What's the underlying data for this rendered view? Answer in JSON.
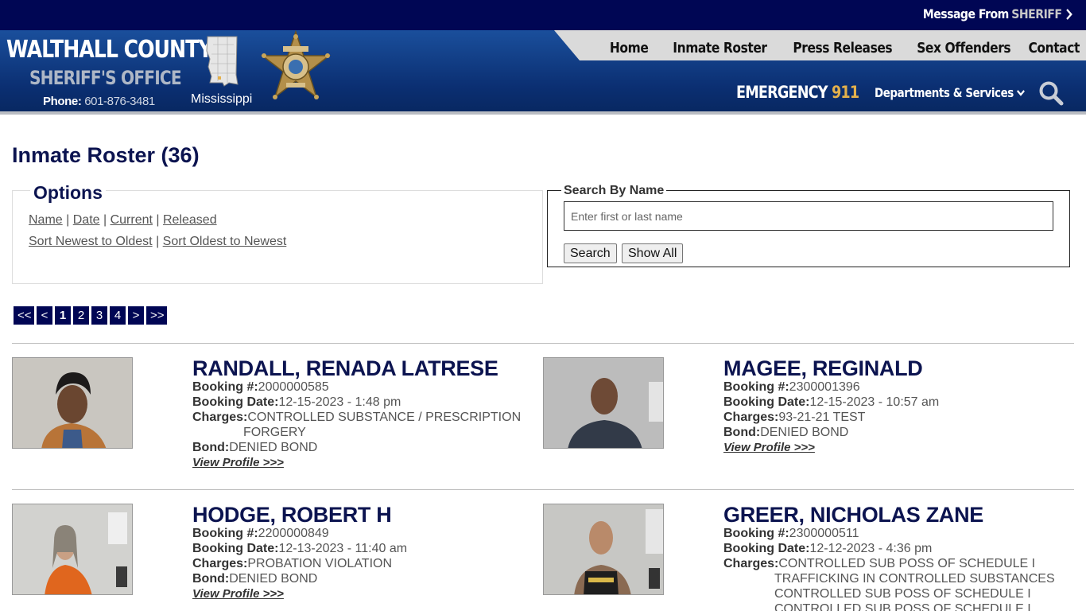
{
  "topbar": {
    "message_prefix": "Message From",
    "message_highlight": "SHERIFF"
  },
  "brand": {
    "title": "WALTHALL COUNTY",
    "subtitle": "SHERIFF'S OFFICE",
    "phone_label": "Phone:",
    "phone_number": "601-876-3481",
    "state": "Mississippi"
  },
  "nav": {
    "items": [
      "Home",
      "Inmate Roster",
      "Press Releases",
      "Sex Offenders",
      "Contact"
    ],
    "emergency_label": "EMERGENCY",
    "emergency_number": "911",
    "departments": "Departments & Services"
  },
  "page": {
    "title": "Inmate Roster (36)"
  },
  "options": {
    "legend": "Options",
    "sort_fields": [
      "Name",
      "Date",
      "Current",
      "Released"
    ],
    "sort_orders": [
      "Sort Newest to Oldest",
      "Sort Oldest to Newest"
    ]
  },
  "search": {
    "legend": "Search By Name",
    "placeholder": "Enter first or last name",
    "search_button": "Search",
    "show_all_button": "Show All"
  },
  "pager": {
    "first": "<<",
    "prev": "<",
    "pages": [
      "1",
      "2",
      "3",
      "4"
    ],
    "next": ">",
    "last": ">>",
    "current": "1"
  },
  "labels": {
    "booking_no": "Booking #:",
    "booking_date": "Booking Date:",
    "charges": "Charges:",
    "bond": "Bond:",
    "view_profile": "View Profile >>>"
  },
  "inmates": [
    {
      "name": "RANDALL, RENADA LATRESE",
      "booking_no": "2000000585",
      "booking_date": "12-15-2023 - 1:48 pm",
      "charges": [
        "CONTROLLED SUBSTANCE / PRESCRIPTION",
        "FORGERY"
      ],
      "bond": "DENIED BOND"
    },
    {
      "name": "MAGEE, REGINALD",
      "booking_no": "2300001396",
      "booking_date": "12-15-2023 - 10:57 am",
      "charges": [
        "93-21-21 TEST"
      ],
      "bond": "DENIED BOND"
    },
    {
      "name": "HODGE, ROBERT H",
      "booking_no": "2200000849",
      "booking_date": "12-13-2023 - 11:40 am",
      "charges": [
        "PROBATION VIOLATION"
      ],
      "bond": "DENIED BOND"
    },
    {
      "name": "GREER, NICHOLAS ZANE",
      "booking_no": "2300000511",
      "booking_date": "12-12-2023 - 4:36 pm",
      "charges": [
        "CONTROLLED SUB POSS OF SCHEDULE I",
        "TRAFFICKING IN CONTROLLED SUBSTANCES",
        "CONTROLLED SUB POSS OF SCHEDULE I",
        "CONTROLLED SUB POSS OF SCHEDULE I"
      ],
      "bond": ""
    }
  ],
  "colors": {
    "navy": "#000654",
    "header_blue": "#1a4f9c",
    "title_navy": "#0c1450",
    "accent_gold": "#e3b04b"
  }
}
